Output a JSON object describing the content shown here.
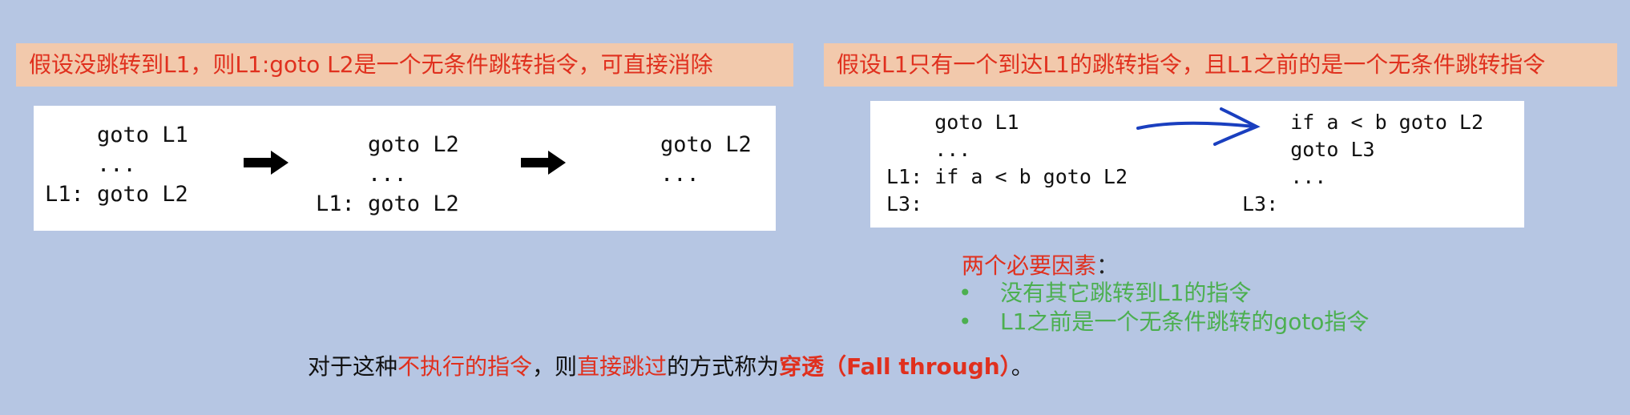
{
  "banners": {
    "left": "假设没跳转到L1，则L1:goto L2是一个无条件跳转指令，可直接消除",
    "right": "假设L1只有一个到达L1的跳转指令，且L1之前的是一个无条件跳转指令"
  },
  "left_example": {
    "step1": "    goto L1\n    ...\nL1: goto L2",
    "step2": "    goto L2\n    ...\nL1: goto L2",
    "step3": "goto L2\n..."
  },
  "right_example": {
    "before": "    goto L1\n    ...\nL1: if a < b goto L2\nL3:",
    "after": "    if a < b goto L2\n    goto L3\n    ...\nL3:"
  },
  "factors": {
    "title": "两个必要因素",
    "colon": "：",
    "items": [
      "没有其它跳转到L1的指令",
      "L1之前是一个无条件跳转的goto指令"
    ]
  },
  "summary": {
    "p1": "对于这种",
    "p2": "不执行的指令",
    "p3": "，则",
    "p4": "直接跳过",
    "p5": "的方式称为",
    "p6": "穿透（Fall through）",
    "p7": "。"
  },
  "colors": {
    "background": "#b6c6e3",
    "banner": "#f2c9ac",
    "red": "#e0301e",
    "green": "#4caf50",
    "arrow_blue": "#1a3fbf"
  },
  "icons": {
    "black_arrow": "right-arrow-icon",
    "blue_arrow": "hand-drawn-arrow-icon"
  }
}
